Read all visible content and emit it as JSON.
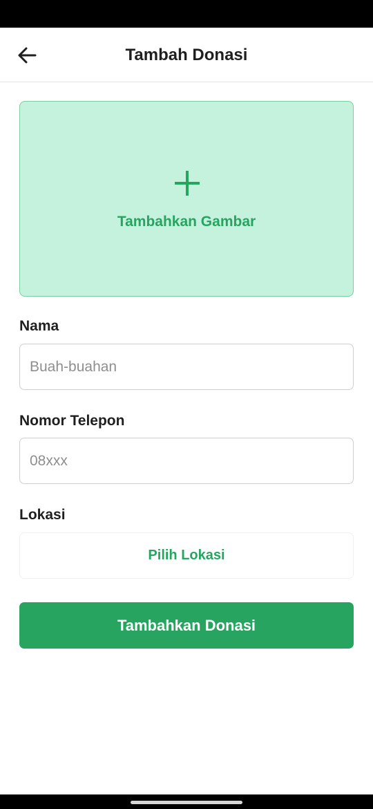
{
  "app_bar": {
    "title": "Tambah Donasi",
    "back_icon": "arrow-left-icon"
  },
  "image_picker": {
    "icon": "plus-icon",
    "label": "Tambahkan Gambar",
    "background_color": "#c4f2dc",
    "accent_color": "#27a560"
  },
  "form": {
    "nama": {
      "label": "Nama",
      "value": "",
      "placeholder": "Buah-buahan"
    },
    "telepon": {
      "label": "Nomor Telepon",
      "value": "",
      "placeholder": "08xxx"
    },
    "lokasi": {
      "label": "Lokasi",
      "button_label": "Pilih Lokasi"
    }
  },
  "submit": {
    "label": "Tambahkan Donasi",
    "background_color": "#27a560"
  }
}
